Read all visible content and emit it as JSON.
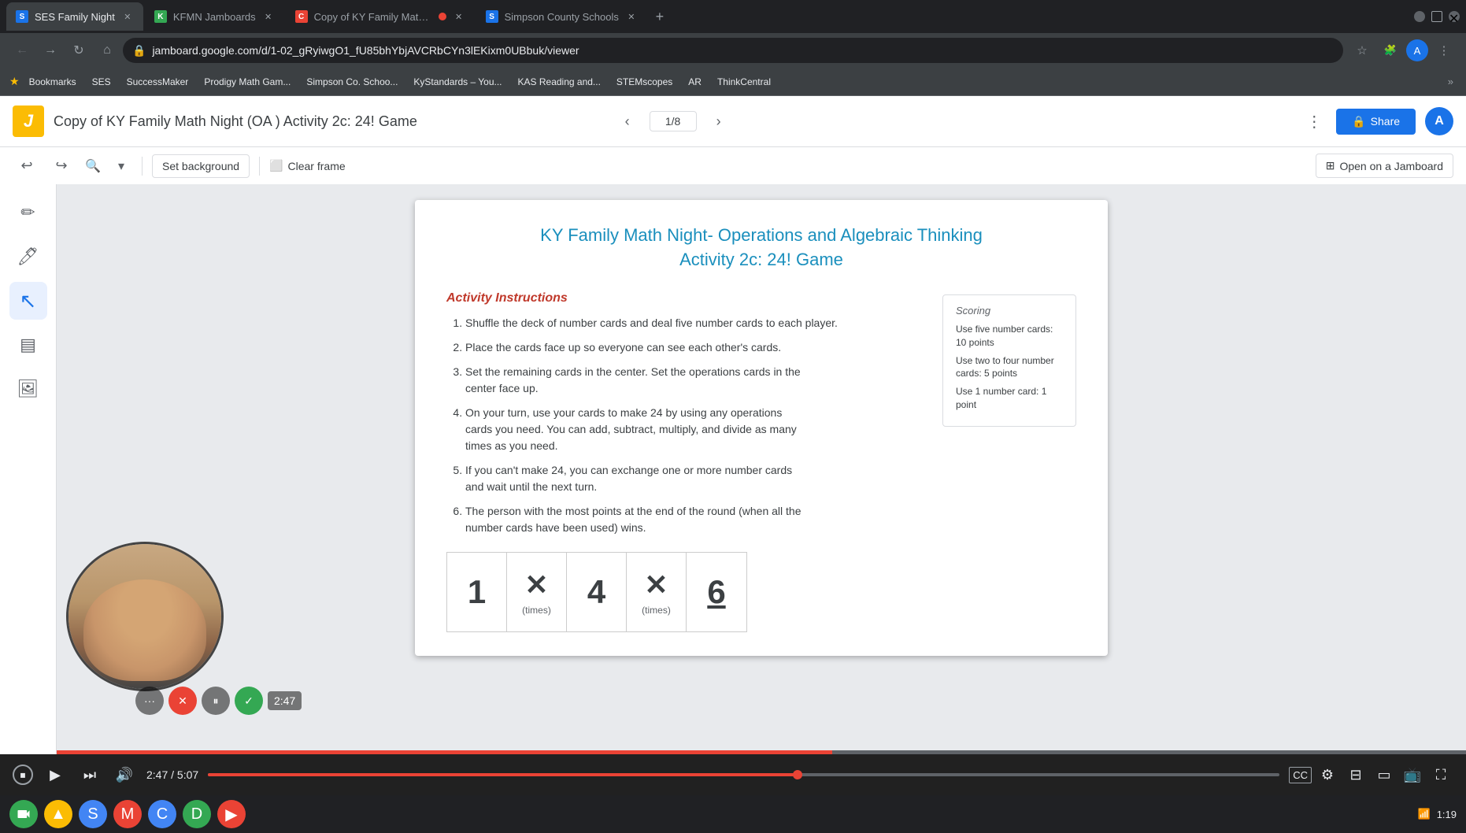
{
  "browser": {
    "tabs": [
      {
        "id": "tab1",
        "favicon_color": "#1a73e8",
        "favicon_letter": "S",
        "label": "SES Family Night",
        "active": true
      },
      {
        "id": "tab2",
        "favicon_color": "#34a853",
        "favicon_letter": "K",
        "label": "KFMN Jamboards",
        "active": false
      },
      {
        "id": "tab3",
        "favicon_color": "#ea4335",
        "favicon_letter": "C",
        "label": "Copy of KY Family Math N...",
        "active": false,
        "dot": true
      },
      {
        "id": "tab4",
        "favicon_color": "#1a73e8",
        "favicon_letter": "S",
        "label": "Simpson County Schools",
        "active": false
      }
    ],
    "address": "jamboard.google.com/d/1-02_gRyiwgO1_fU85bhYbjAVCRbCYn3lEKixm0UBbuk/viewer"
  },
  "bookmarks": [
    {
      "label": "Bookmarks"
    },
    {
      "label": "SES"
    },
    {
      "label": "SuccessMaker"
    },
    {
      "label": "Prodigy Math Gam..."
    },
    {
      "label": "Simpson Co. Schoo..."
    },
    {
      "label": "KyStandards – You..."
    },
    {
      "label": "KAS Reading and..."
    },
    {
      "label": "STEMscopes"
    },
    {
      "label": "AR"
    },
    {
      "label": "ThinkCentral"
    }
  ],
  "app": {
    "logo_char": "🟡",
    "title": "Copy of KY Family Math Night (OA ) Activity 2c: 24! Game",
    "page_indicator": "1/8",
    "share_label": "Share",
    "share_icon": "🔒",
    "user_initial": "A"
  },
  "edit_toolbar": {
    "set_background_label": "Set background",
    "clear_frame_label": "Clear frame",
    "open_jamboard_label": "Open on a Jamboard"
  },
  "jamboard": {
    "title_line1": "KY Family Math Night- Operations and Algebraic Thinking",
    "title_line2": "Activity 2c: 24! Game",
    "activity_instructions_label": "Activity Instructions",
    "instructions": [
      "Shuffle the deck of number cards and deal five number cards to each player.",
      "Place the cards face up so everyone can see each other's cards.",
      "Set the remaining cards in the center. Set the operations cards in the center face up.",
      "On your turn, use your cards to make 24 by using any operations cards you need. You can add, subtract, multiply, and divide as many times as you need.",
      "If you can't make 24, you can exchange one or more number cards and wait until the next turn.",
      "The person with the most points at the end of the round (when all the number cards have been used) wins."
    ],
    "scoring": {
      "title": "Scoring",
      "items": [
        "Use five number cards: 10 points",
        "Use two to four number cards: 5 points",
        "Use 1 number card: 1 point"
      ]
    },
    "cards": [
      {
        "value": "1",
        "label": "",
        "underlined": false
      },
      {
        "value": "✕",
        "label": "(times)",
        "is_operator": true
      },
      {
        "value": "4",
        "label": "",
        "underlined": false
      },
      {
        "value": "✕",
        "label": "(times)",
        "is_operator": true
      },
      {
        "value": "6",
        "label": "",
        "underlined": true
      }
    ]
  },
  "video": {
    "current_time": "2:47",
    "total_time": "5:07",
    "progress_percent": 55
  },
  "sidebar_tools": [
    {
      "id": "pencil",
      "icon": "✏️",
      "active": false
    },
    {
      "id": "eraser",
      "icon": "🖊",
      "active": false
    },
    {
      "id": "cursor",
      "icon": "↖",
      "active": true
    },
    {
      "id": "sticky",
      "icon": "📋",
      "active": false
    },
    {
      "id": "image",
      "icon": "🖼",
      "active": false
    }
  ],
  "meeting_controls": {
    "dots_label": "···",
    "x_label": "✕",
    "pause_label": "⏸",
    "check_label": "✓",
    "timer": "2:47"
  },
  "taskbar_apps": [
    {
      "id": "meet",
      "bg": "#34a853",
      "char": "M"
    },
    {
      "id": "drive",
      "bg": "#fbbc04",
      "char": "▲"
    },
    {
      "id": "slides",
      "bg": "#4285f4",
      "char": "S"
    },
    {
      "id": "gmail",
      "bg": "#ea4335",
      "char": "M"
    },
    {
      "id": "chrome",
      "bg": "#4285f4",
      "char": "C"
    },
    {
      "id": "docs",
      "bg": "#34a853",
      "char": "D"
    },
    {
      "id": "youtube",
      "bg": "#ea4335",
      "char": "▶"
    }
  ]
}
